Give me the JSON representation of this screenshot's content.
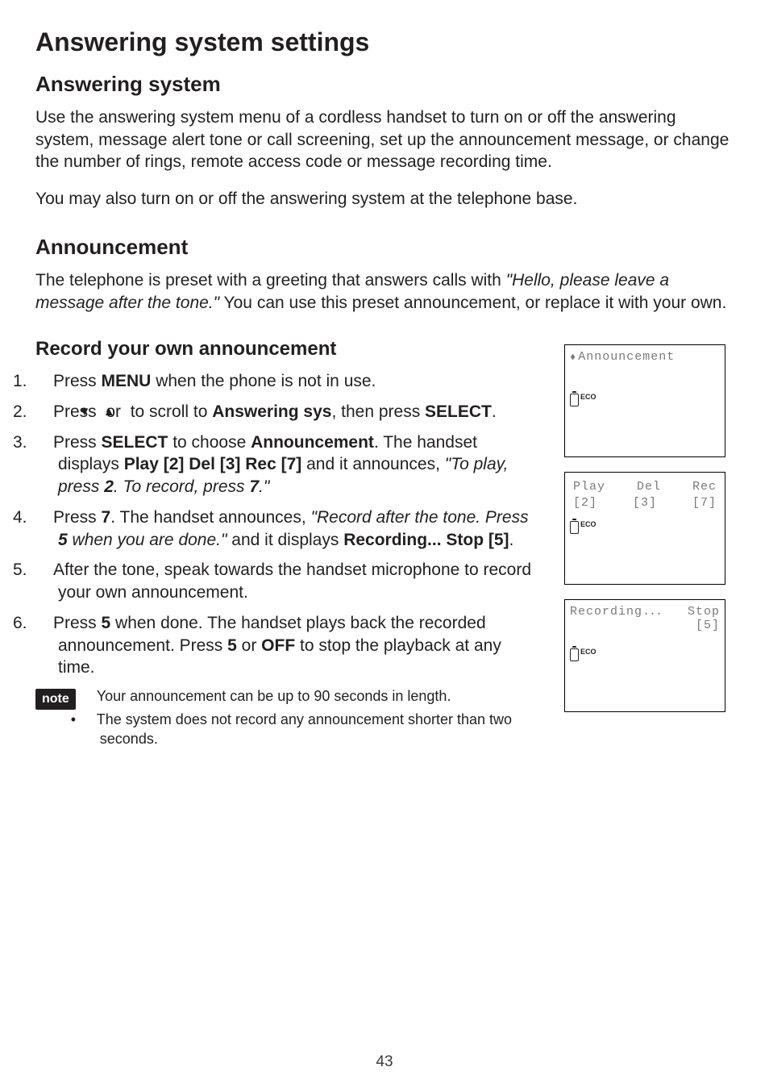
{
  "title": "Answering system settings",
  "section_answering": {
    "heading": "Answering system",
    "p1": "Use the answering system menu of a cordless handset to turn on or off the answering system, message alert tone or call screening, set up the announcement message, or change the number of rings, remote access code or message recording time.",
    "p2": "You may also turn on or off the answering system at the telephone base."
  },
  "section_announcement": {
    "heading": "Announcement",
    "p1_a": "The telephone is preset with a greeting that answers calls with ",
    "p1_quote": "\"Hello, please leave a message after the tone.\"",
    "p1_b": "  You can use this preset announcement, or replace it with your own."
  },
  "section_record": {
    "heading": "Record your own announcement",
    "steps": [
      {
        "n": "1.",
        "parts": [
          {
            "t": "Press "
          },
          {
            "t": "MENU",
            "s": "bold"
          },
          {
            "t": " when the phone is not in use."
          }
        ]
      },
      {
        "n": "2.",
        "parts": [
          {
            "t": "Press "
          },
          {
            "t": "▼",
            "s": "tri"
          },
          {
            "t": " or "
          },
          {
            "t": "▲",
            "s": "tri"
          },
          {
            "t": " to scroll to "
          },
          {
            "t": "Answering sys",
            "s": "bold"
          },
          {
            "t": ", then press "
          },
          {
            "t": "SELECT",
            "s": "bold"
          },
          {
            "t": "."
          }
        ]
      },
      {
        "n": "3.",
        "parts": [
          {
            "t": "Press "
          },
          {
            "t": "SELECT",
            "s": "bold"
          },
          {
            "t": " to choose "
          },
          {
            "t": "Announcement",
            "s": "bold"
          },
          {
            "t": ". The handset displays "
          },
          {
            "t": "Play [2] Del [3] Rec [7]",
            "s": "bold"
          },
          {
            "t": " and it announces, "
          },
          {
            "t": "\"To play, press ",
            "s": "italic"
          },
          {
            "t": "2",
            "s": "bold-italic"
          },
          {
            "t": ". To record, press ",
            "s": "italic"
          },
          {
            "t": "7",
            "s": "bold-italic"
          },
          {
            "t": ".\"",
            "s": "italic"
          }
        ]
      },
      {
        "n": "4.",
        "parts": [
          {
            "t": "Press "
          },
          {
            "t": "7",
            "s": "bold"
          },
          {
            "t": ". The handset announces, "
          },
          {
            "t": "\"Record after the tone. Press ",
            "s": "italic"
          },
          {
            "t": "5",
            "s": "bold-italic"
          },
          {
            "t": " when you are done.\"",
            "s": "italic"
          },
          {
            "t": "  and it displays "
          },
          {
            "t": "Recording... Stop [5]",
            "s": "bold"
          },
          {
            "t": "."
          }
        ]
      },
      {
        "n": "5.",
        "parts": [
          {
            "t": "After the tone, speak towards the handset microphone to record your own announcement."
          }
        ]
      },
      {
        "n": "6.",
        "parts": [
          {
            "t": "Press "
          },
          {
            "t": "5",
            "s": "bold"
          },
          {
            "t": " when done. The handset plays back the recorded announcement. Press "
          },
          {
            "t": "5",
            "s": "bold"
          },
          {
            "t": " or "
          },
          {
            "t": "OFF",
            "s": "bold"
          },
          {
            "t": " to stop the playback at any time."
          }
        ]
      }
    ],
    "note_label": "note",
    "notes": [
      "Your announcement can be up to 90 seconds in length.",
      "The system does not record any announcement shorter than two seconds."
    ]
  },
  "screens": {
    "s1": {
      "line1": "Announcement",
      "eco": "ECO"
    },
    "s2": {
      "c1": "Play",
      "c2": "Del",
      "c3": "Rec",
      "b1": "[2]",
      "b2": "[3]",
      "b3": "[7]",
      "eco": "ECO"
    },
    "s3": {
      "l1a": "Recording",
      "l1b": "Stop",
      "l2": "[5]",
      "eco": "ECO",
      "dots": "..."
    }
  },
  "page_number": "43"
}
